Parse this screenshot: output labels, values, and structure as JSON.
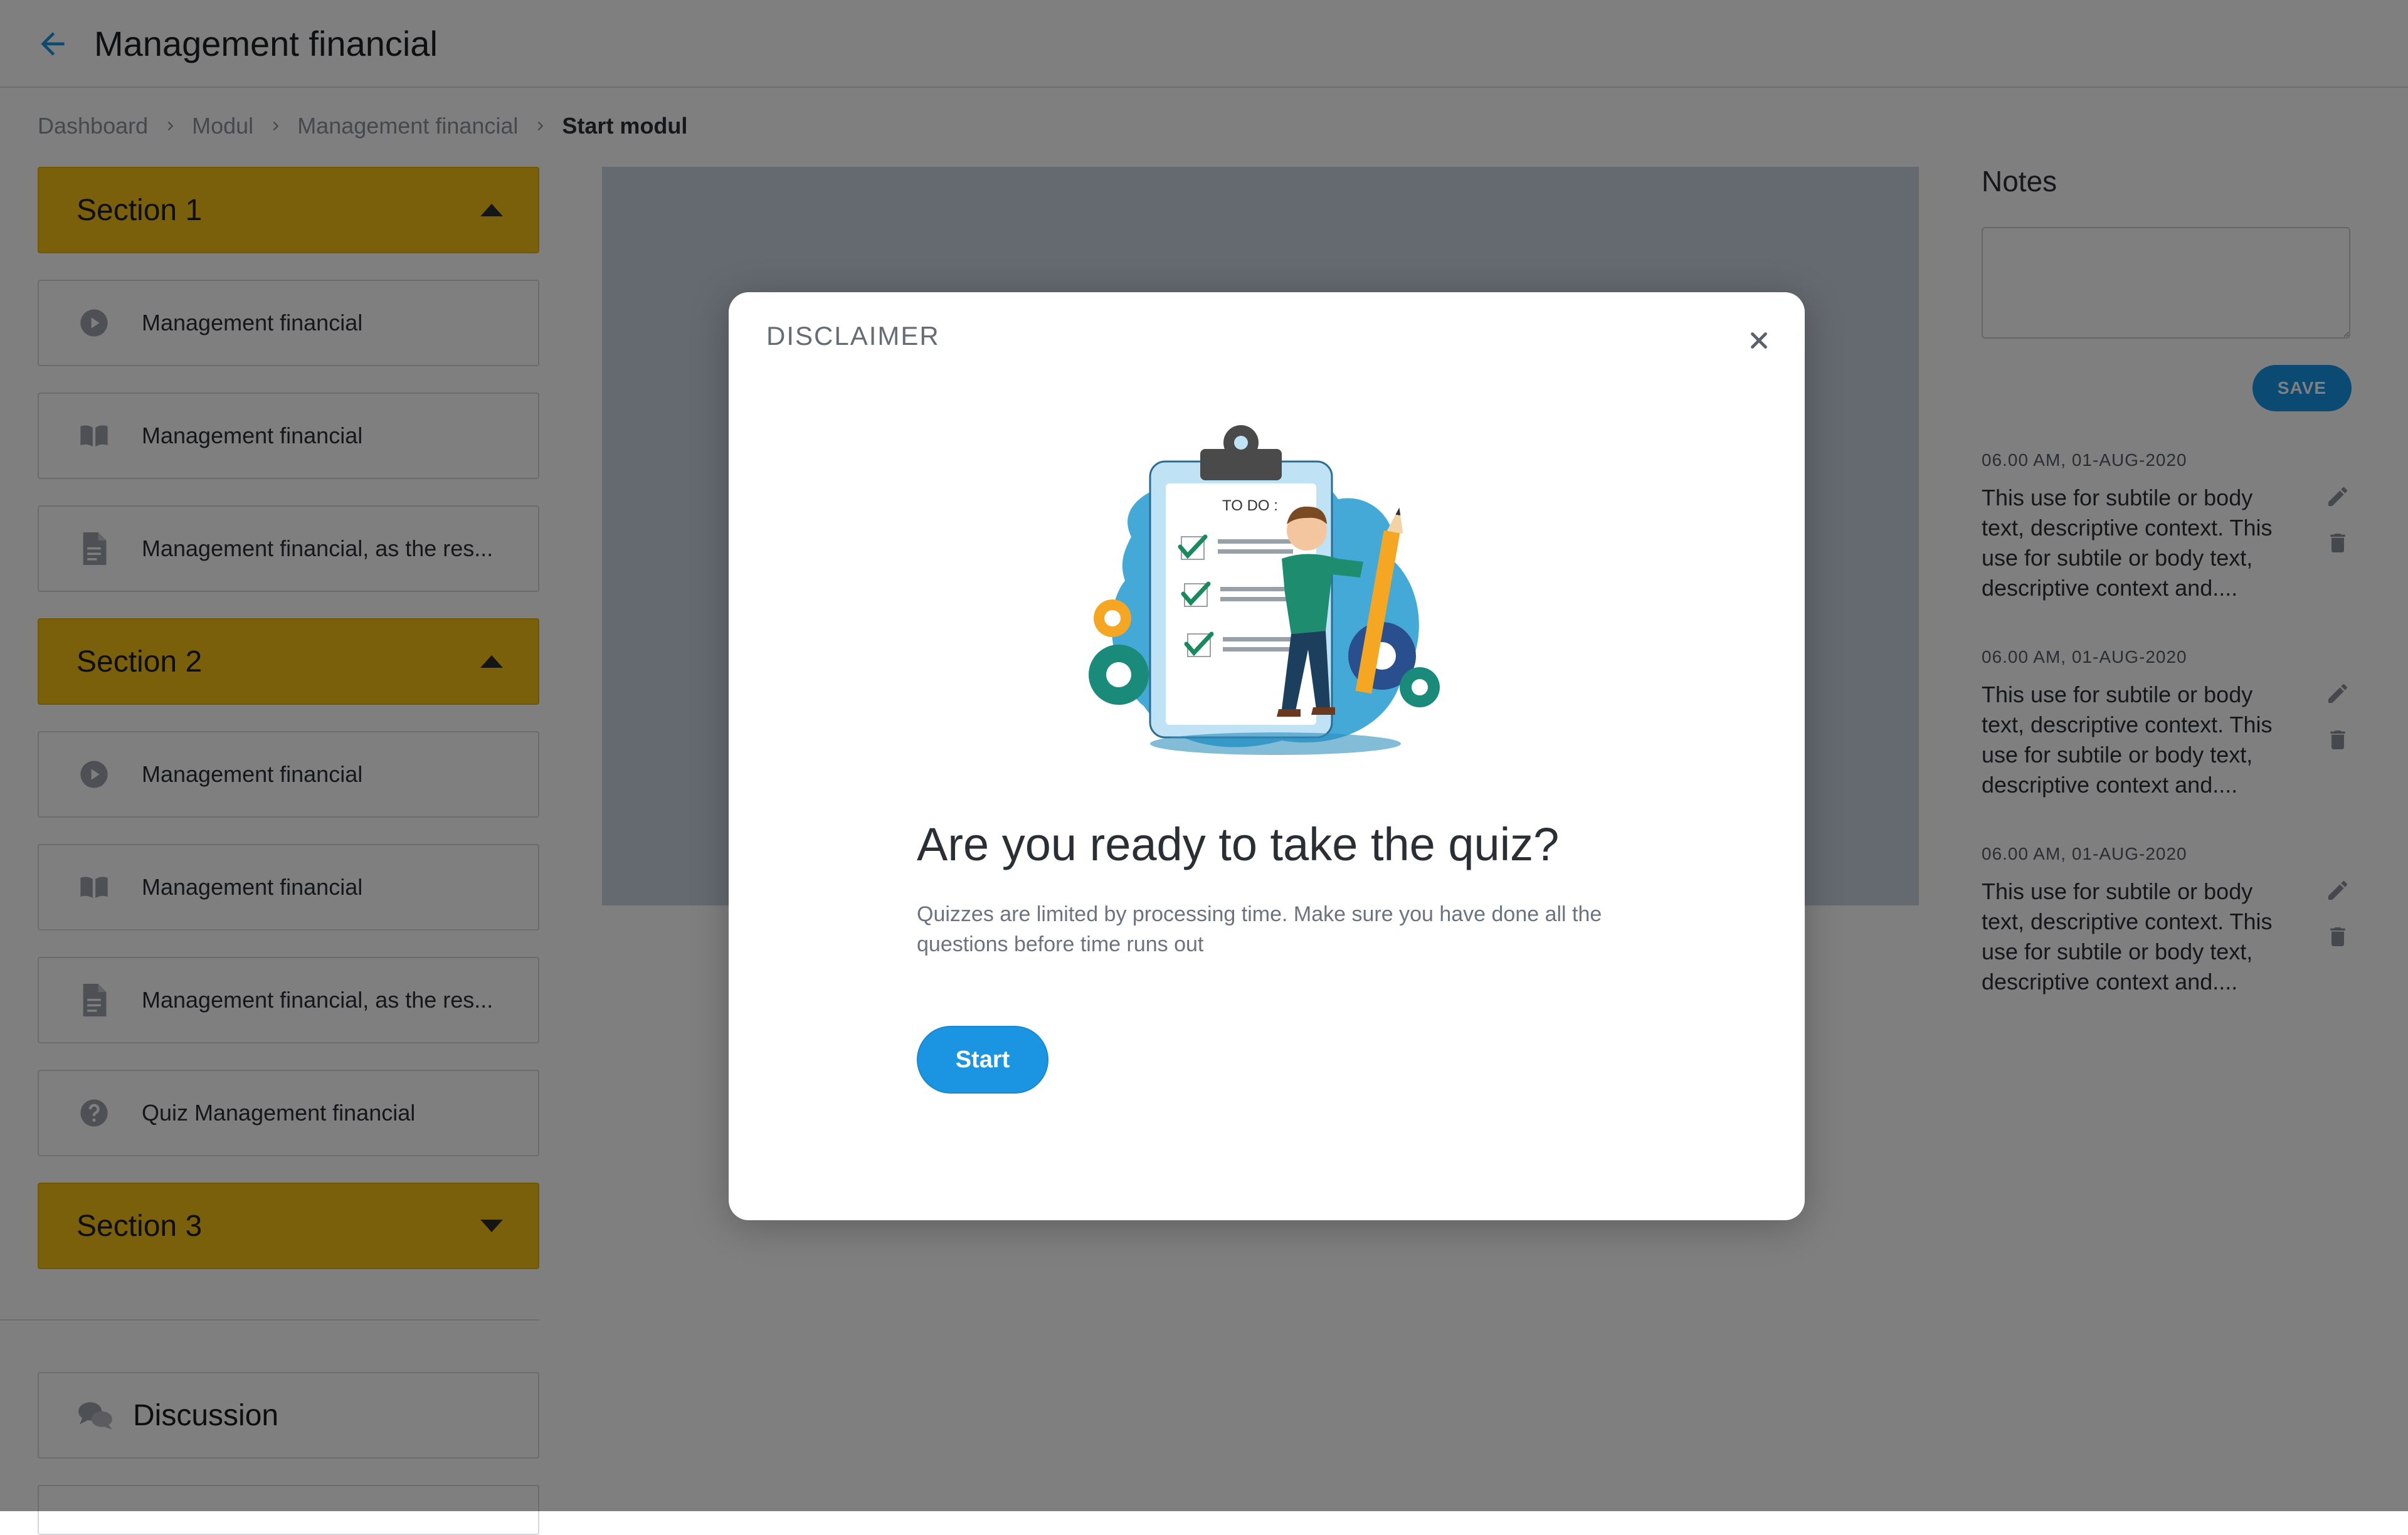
{
  "header": {
    "title": "Management financial"
  },
  "breadcrumb": [
    "Dashboard",
    "Modul",
    "Management financial",
    "Start modul"
  ],
  "sidebar": {
    "sections": [
      {
        "label": "Section 1",
        "expanded": true,
        "items": [
          {
            "icon": "play-circle-icon",
            "label": "Management financial"
          },
          {
            "icon": "book-icon",
            "label": "Management financial"
          },
          {
            "icon": "document-icon",
            "label": "Management financial, as the res..."
          }
        ]
      },
      {
        "label": "Section 2",
        "expanded": true,
        "items": [
          {
            "icon": "play-circle-icon",
            "label": "Management financial"
          },
          {
            "icon": "book-icon",
            "label": "Management financial"
          },
          {
            "icon": "document-icon",
            "label": "Management financial, as the res..."
          },
          {
            "icon": "question-circle-icon",
            "label": "Quiz Management financial"
          }
        ]
      },
      {
        "label": "Section 3",
        "expanded": false,
        "items": []
      }
    ],
    "discussion_label": "Discussion"
  },
  "notes": {
    "title": "Notes",
    "input_value": "",
    "save_label": "SAVE",
    "entries": [
      {
        "time": "06.00 AM, 01-AUG-2020",
        "text": "This use for subtile or body text, descriptive context. This use for subtile or body text, descriptive context and...."
      },
      {
        "time": "06.00 AM, 01-AUG-2020",
        "text": "This use for subtile or body text, descriptive context. This use for subtile or body text, descriptive context and...."
      },
      {
        "time": "06.00 AM, 01-AUG-2020",
        "text": "This use for subtile or body text, descriptive context. This use for subtile or body text, descriptive context and...."
      }
    ]
  },
  "modal": {
    "title": "DISCLAIMER",
    "illustration_text": "TO DO :",
    "heading": "Are you ready to take the quiz?",
    "description": "Quizzes are limited by processing time. Make sure you have done all the questions before time runs out",
    "start_label": "Start"
  },
  "colors": {
    "section_yellow": "#f5c115",
    "primary_blue": "#1b95e2",
    "overlay": "rgba(0,0,0,0.5)"
  }
}
